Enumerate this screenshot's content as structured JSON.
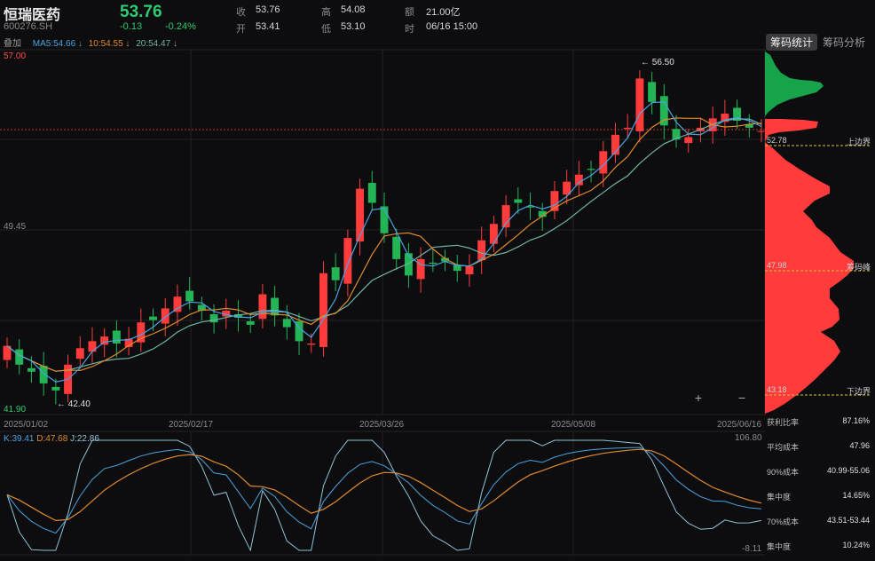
{
  "stock": {
    "name": "恒瑞医药",
    "code": "600276.SH",
    "price": "53.76",
    "change": "-0.13",
    "change_pct": "-0.24%"
  },
  "quote": {
    "close_label": "收",
    "close": "53.76",
    "open_label": "开",
    "open": "53.41",
    "high_label": "高",
    "high": "54.08",
    "low_label": "低",
    "low": "53.10",
    "amount_label": "额",
    "amount": "21.00亿",
    "time_label": "时",
    "time": "06/16 15:00"
  },
  "overlay_label": "叠加",
  "ma": {
    "ma5": "MA5:54.66 ↓",
    "ma10": "10:54.55 ↓",
    "ma20": "20:54.47 ↓"
  },
  "tabs": {
    "chip_stats": "筹码统计",
    "chip_analysis": "筹码分析"
  },
  "price_axis": {
    "top": "57.00",
    "mid": "49.45",
    "bottom": "41.90"
  },
  "annotations": {
    "high": "← 56.50",
    "low": "← 42.40"
  },
  "dates": [
    "2025/01/02",
    "2025/02/17",
    "2025/03/26",
    "2025/05/08",
    "2025/06/16"
  ],
  "kdj": {
    "k": "K:39.41",
    "d": "D:47.68",
    "j": "J:22.86",
    "max": "106.80",
    "min": "-8.11"
  },
  "chip": {
    "upper_value": "52.78",
    "upper_label": "上边界",
    "peak_value": "47.98",
    "peak_label": "筹码峰",
    "lower_value": "43.18",
    "lower_label": "下边界"
  },
  "stats": [
    {
      "label": "获利比率",
      "value": "87.16%"
    },
    {
      "label": "平均成本",
      "value": "47.96"
    },
    {
      "label": "90%成本",
      "value": "40.99-55.06"
    },
    {
      "label": "集中度",
      "value": "14.65%"
    },
    {
      "label": "70%成本",
      "value": "43.51-53.44"
    },
    {
      "label": "集中度",
      "value": "10.24%"
    }
  ],
  "colors": {
    "up": "#ff3b3b",
    "down": "#22b455",
    "ma5": "#4aa3df",
    "ma10": "#e08a2e",
    "ma20": "#6fb3a8"
  },
  "zoom": {
    "plus": "+",
    "minus": "−"
  },
  "chart_data": {
    "type": "candlestick",
    "price_range": [
      41.9,
      57.0
    ],
    "current_price": 53.76,
    "x": [
      "2025/01/02",
      "2025/02/17",
      "2025/03/26",
      "2025/05/08",
      "2025/06/16"
    ],
    "close_approx": [
      44.6,
      43.8,
      43.5,
      43.0,
      42.7,
      43.8,
      44.5,
      44.8,
      45.0,
      44.7,
      44.9,
      45.6,
      45.7,
      46.2,
      46.7,
      46.5,
      46.1,
      45.6,
      46.1,
      45.8,
      45.5,
      46.8,
      45.9,
      45.4,
      44.8,
      44.7,
      47.7,
      47.4,
      49.2,
      51.3,
      50.7,
      49.4,
      48.3,
      47.6,
      48.3,
      48.1,
      48.2,
      47.8,
      48.0,
      49.1,
      49.8,
      50.6,
      50.7,
      50.5,
      50.1,
      51.2,
      51.6,
      51.9,
      52.1,
      52.9,
      53.6,
      53.9,
      56.0,
      55.0,
      54.0,
      53.4,
      53.5,
      53.9,
      54.3,
      54.5,
      54.2,
      53.9,
      53.76
    ],
    "peak_high": 56.5,
    "trough_low": 42.4,
    "kdj_range": [
      -8.11,
      106.8
    ],
    "kdj_last": {
      "K": 39.41,
      "D": 47.68,
      "J": 22.86
    }
  }
}
